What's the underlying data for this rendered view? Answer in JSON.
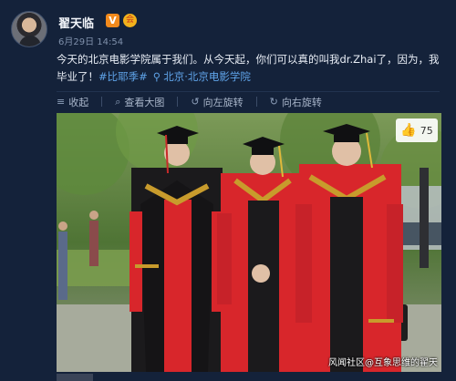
{
  "post": {
    "username": "翟天临",
    "verified_badge": "V",
    "member_badge": "会",
    "timestamp": "6月29日 14:54",
    "text": "今天的北京电影学院属于我们。从今天起，你们可以真的叫我dr.Zhai了，因为，我毕业了！",
    "hashtag": "#比耶季#",
    "location": "北京·北京电影学院",
    "icons": {
      "location": "location-pin-icon"
    }
  },
  "toolbar": {
    "collapse": "收起",
    "view_large": "查看大图",
    "rotate_left": "向左旋转",
    "rotate_right": "向右旋转"
  },
  "photo": {
    "like_count": "75",
    "watermark": "风闻社区@互象思维的翟天"
  },
  "colors": {
    "background": "#14223a",
    "link": "#5fa3e8",
    "gown_red": "#d8262b"
  }
}
